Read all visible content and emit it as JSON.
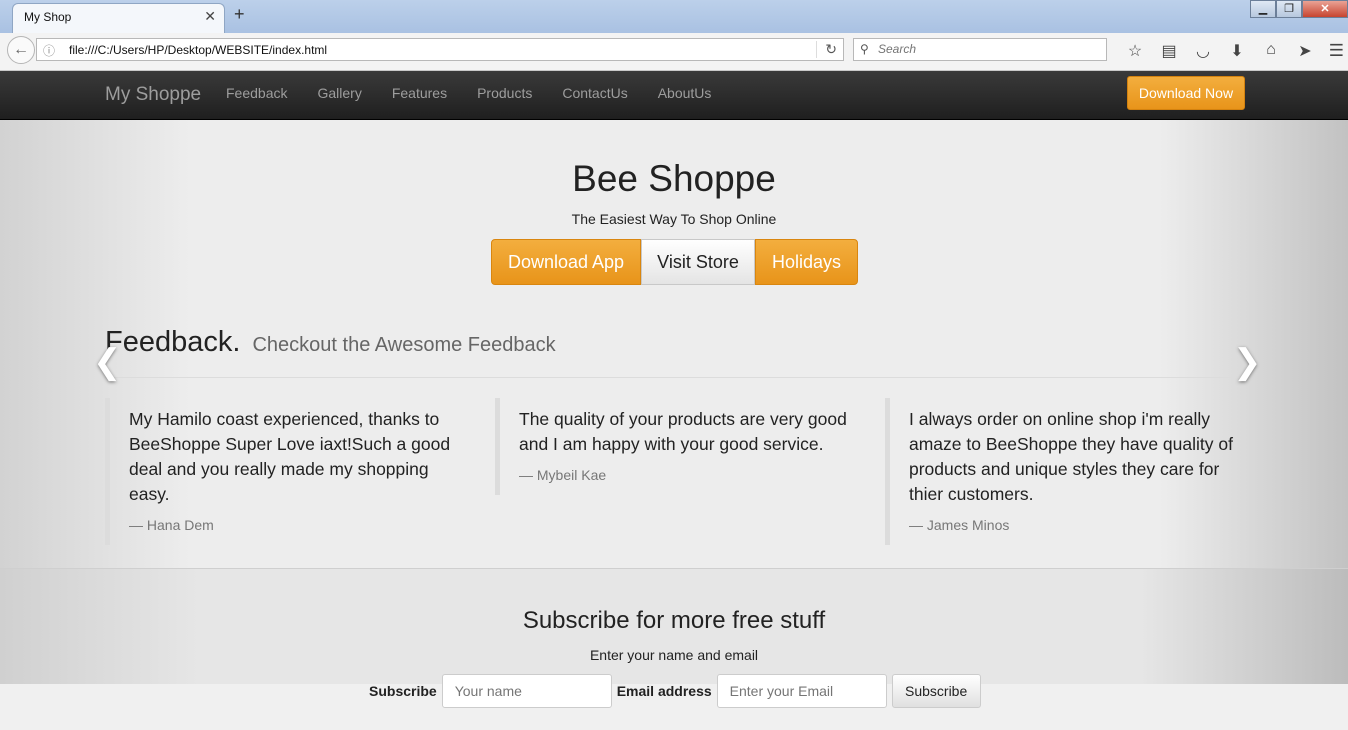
{
  "browser": {
    "tab_title": "My Shop",
    "tab_close": "✕",
    "new_tab": "+",
    "url": "file:///C:/Users/HP/Desktop/WEBSITE/index.html",
    "search_placeholder": "Search",
    "window_controls": [
      "▁",
      "❐",
      "✕"
    ]
  },
  "site_nav": {
    "brand": "My Shoppe",
    "links": [
      "Feedback",
      "Gallery",
      "Features",
      "Products",
      "ContactUs",
      "AboutUs"
    ],
    "cta": "Download Now"
  },
  "hero": {
    "title": "Bee Shoppe",
    "subtitle": "The Easiest Way To Shop Online",
    "buttons": [
      "Download App",
      "Visit Store",
      "Holidays"
    ]
  },
  "feedback": {
    "heading": "Feedback.",
    "subheading": "Checkout the Awesome Feedback",
    "quotes": [
      {
        "text": "My Hamilo coast experienced, thanks to BeeShoppe Super Love iaxt!Such a good deal and you really made my shopping easy.",
        "author": "— Hana Dem"
      },
      {
        "text": "The quality of your products are very good and I am happy with your good service.",
        "author": "— Mybeil Kae"
      },
      {
        "text": "I always order on online shop i'm really amaze to BeeShoppe they have quality of products and unique styles they care for thier customers.",
        "author": "— James Minos"
      }
    ]
  },
  "subscribe": {
    "title": "Subscribe for more free stuff",
    "text": "Enter your name and email",
    "name_label": "Subscribe",
    "name_placeholder": "Your name",
    "email_label": "Email address",
    "email_placeholder": "Enter your Email",
    "button": "Subscribe"
  },
  "colors": {
    "accent_orange": "#eb9a27",
    "nav_dark": "#2b2b2b"
  }
}
